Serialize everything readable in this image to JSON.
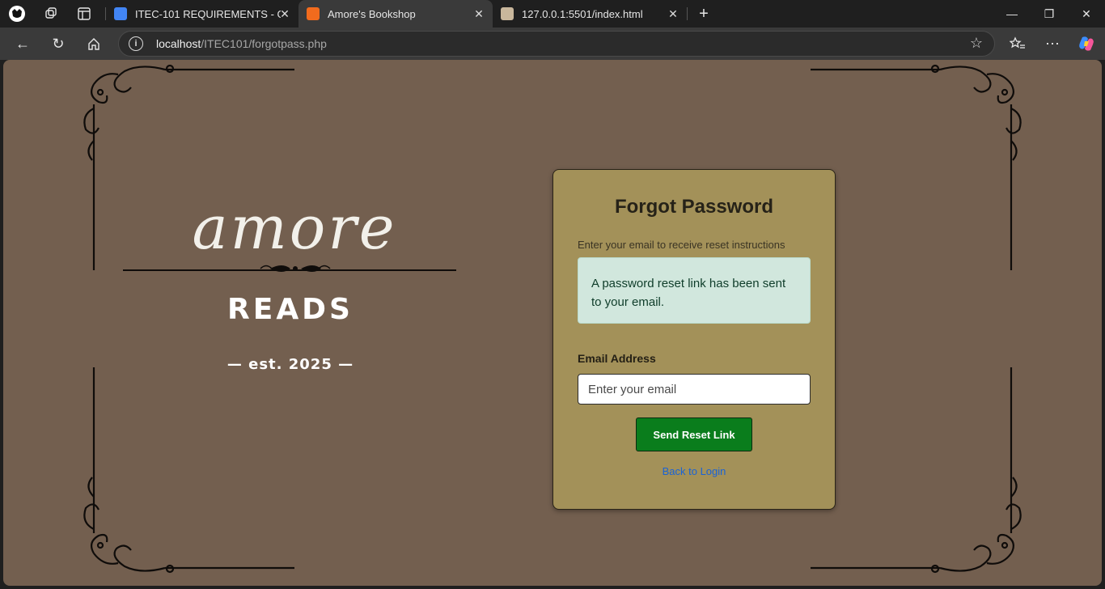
{
  "browser": {
    "tabs": [
      {
        "title": "ITEC-101 REQUIREMENTS - Goog",
        "favicon_color": "#4285f4"
      },
      {
        "title": "Amore's Bookshop",
        "favicon_color": "#f26b1d"
      },
      {
        "title": "127.0.0.1:5501/index.html",
        "favicon_color": "#c9b79c"
      }
    ],
    "url_host": "localhost",
    "url_path": "/ITEC101/forgotpass.php"
  },
  "brand": {
    "logo_word": "amore",
    "reads": "READS",
    "est": "— est. 2025 —"
  },
  "form": {
    "title": "Forgot Password",
    "subtitle": "Enter your email to receive reset instructions",
    "alert": "A password reset link has been sent to your email.",
    "email_label": "Email Address",
    "email_placeholder": "Enter your email",
    "email_value": "",
    "submit_label": "Send Reset Link",
    "back_link": "Back to Login"
  },
  "colors": {
    "page_bg": "#735f4f",
    "card_bg": "#a39159",
    "button": "#0a7d1c",
    "alert_bg": "#d1e7dd",
    "link": "#1a63d6"
  }
}
